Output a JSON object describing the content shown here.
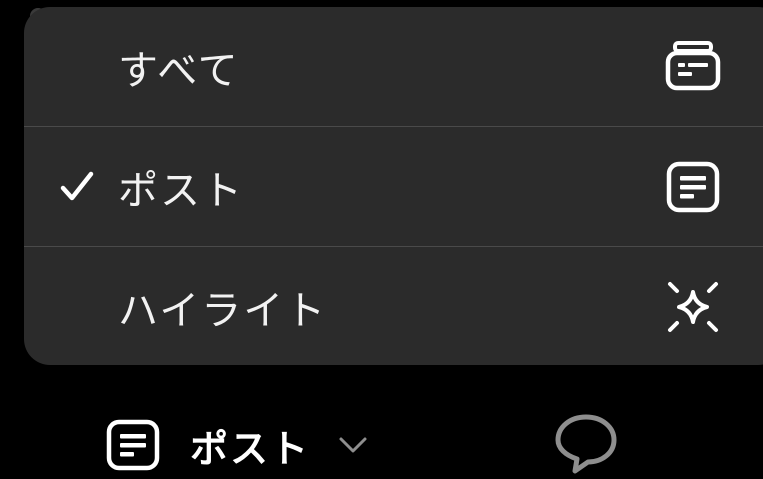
{
  "menu": {
    "items": [
      {
        "label": "すべて",
        "selected": false,
        "icon": "stack-card-icon"
      },
      {
        "label": "ポスト",
        "selected": true,
        "icon": "post-card-icon"
      },
      {
        "label": "ハイライト",
        "selected": false,
        "icon": "sparkle-icon"
      }
    ]
  },
  "bottom_bar": {
    "feed_selector_label": "ポスト",
    "selector_icon": "post-card-icon",
    "chevron": "chevron-down-icon",
    "chat_icon": "speech-bubble-icon"
  },
  "colors": {
    "background": "#000000",
    "menu_background": "#2b2b2b",
    "divider": "#4a4a4a",
    "text": "#f2f2f2",
    "muted_icon": "#8e8e8e"
  }
}
